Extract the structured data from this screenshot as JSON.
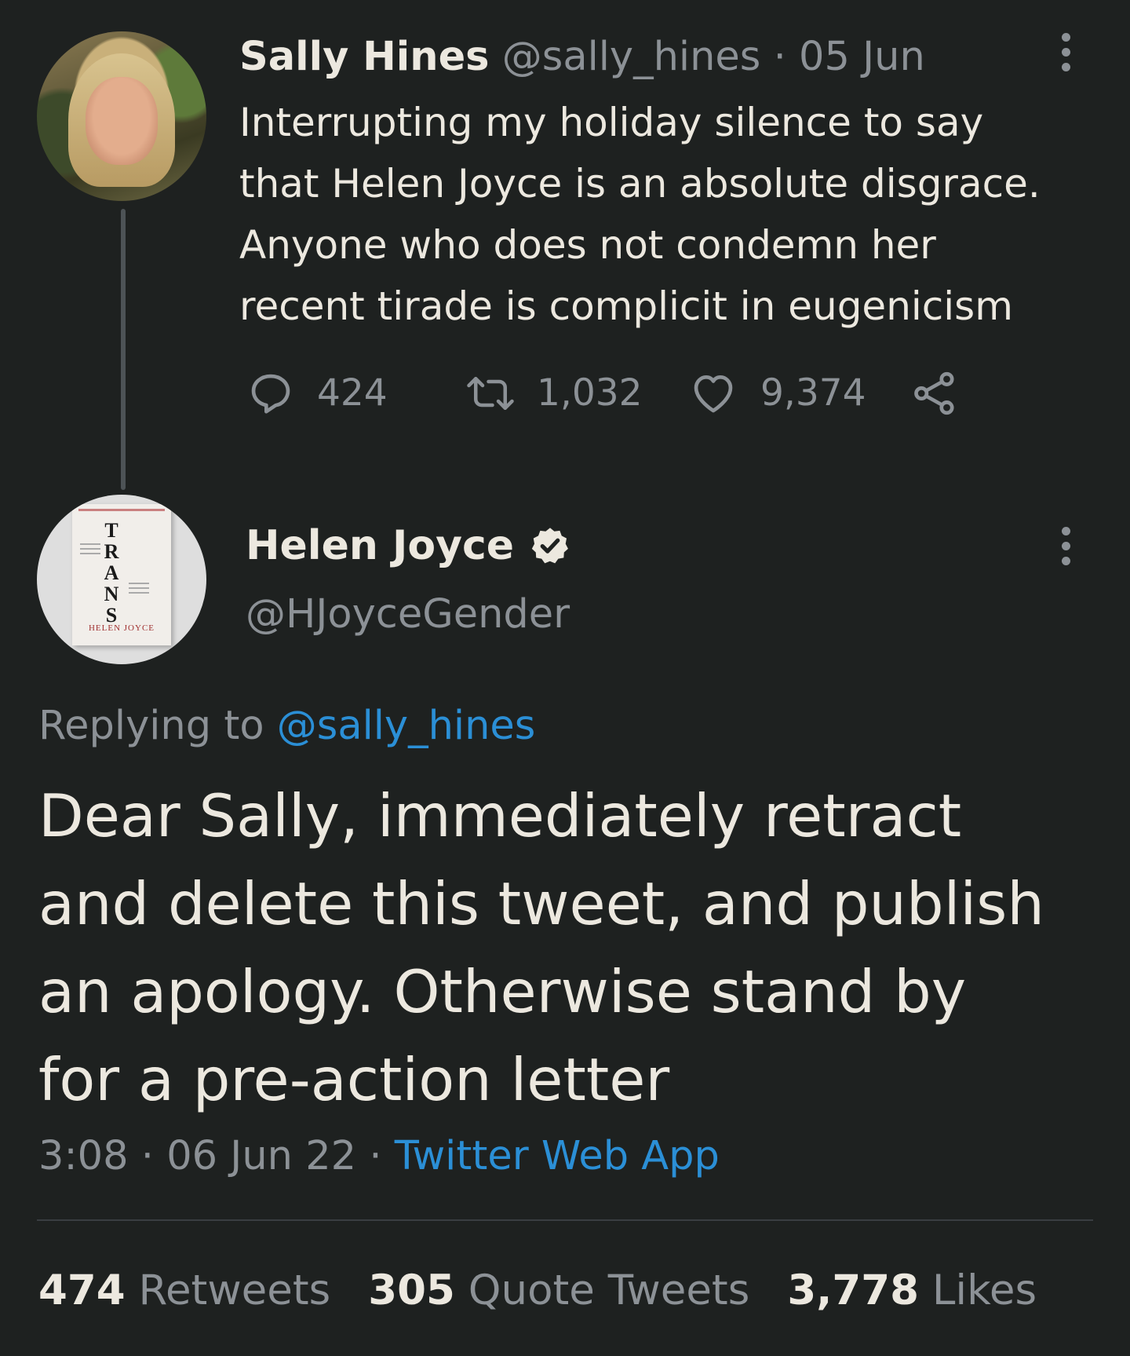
{
  "parent_tweet": {
    "display_name": "Sally Hines",
    "handle": "@sally_hines",
    "separator": "·",
    "date": "05 Jun",
    "text_lines": [
      "Interrupting my holiday silence to say",
      "that Helen Joyce is an absolute disgrace.",
      "Anyone who does not condemn her",
      "recent tirade is complicit in eugenicism"
    ],
    "replies": "424",
    "retweets": "1,032",
    "likes": "9,374"
  },
  "main_tweet": {
    "display_name": "Helen Joyce",
    "handle": "@HJoyceGender",
    "verified": true,
    "avatar_book": {
      "title_letters": [
        "T",
        "R",
        "A",
        "N",
        "S"
      ],
      "author": "HELEN JOYCE"
    },
    "replying_label": "Replying to",
    "replying_handle": "@sally_hines",
    "text_lines": [
      "Dear Sally, immediately retract",
      "and delete this tweet, and publish",
      "an apology. Otherwise stand by",
      "for a pre-action letter"
    ],
    "time": "3:08",
    "separator": "·",
    "date": "06 Jun 22",
    "source": "Twitter Web App",
    "stats": {
      "retweets_count": "474",
      "retweets_label": "Retweets",
      "quotes_count": "305",
      "quotes_label": "Quote Tweets",
      "likes_count": "3,778",
      "likes_label": "Likes"
    }
  },
  "colors": {
    "background": "#1e2120",
    "text": "#ece8df",
    "secondary": "#8c9196",
    "link": "#2b8fd6"
  }
}
